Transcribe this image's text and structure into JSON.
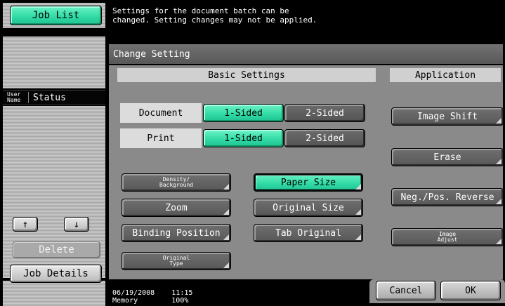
{
  "left_panel": {
    "job_list_label": "Job List",
    "user_name_header": "User Name",
    "status_header": "Status",
    "arrow_up": "↑",
    "arrow_down": "↓",
    "delete_label": "Delete",
    "job_details_label": "Job Details"
  },
  "message": "Settings for the document batch can be\nchanged. Setting changes may not be applied.",
  "dialog": {
    "title": "Change Setting",
    "basic": {
      "header": "Basic Settings",
      "document_label": "Document",
      "print_label": "Print",
      "document_options": [
        "1-Sided",
        "2-Sided"
      ],
      "document_selected": "1-Sided",
      "print_options": [
        "1-Sided",
        "2-Sided"
      ],
      "print_selected": "1-Sided",
      "density_background": "Density/\nBackground",
      "paper_size": "Paper Size",
      "zoom": "Zoom",
      "original_size": "Original Size",
      "binding_position": "Binding Position",
      "tab_original": "Tab Original",
      "original_type": "Original\nType"
    },
    "application": {
      "header": "Application",
      "image_shift": "Image Shift",
      "erase": "Erase",
      "neg_pos_reverse": "Neg./Pos. Reverse",
      "image_adjust": "Image\nAdjust"
    }
  },
  "status_bar": {
    "date_time": "06/19/2008    11:15\nMemory        100%",
    "cancel_label": "Cancel",
    "ok_label": "OK"
  },
  "colors": {
    "selected_green": "#2fd9a3",
    "background_black": "#000000",
    "panel_gray": "#8a8a8a"
  }
}
